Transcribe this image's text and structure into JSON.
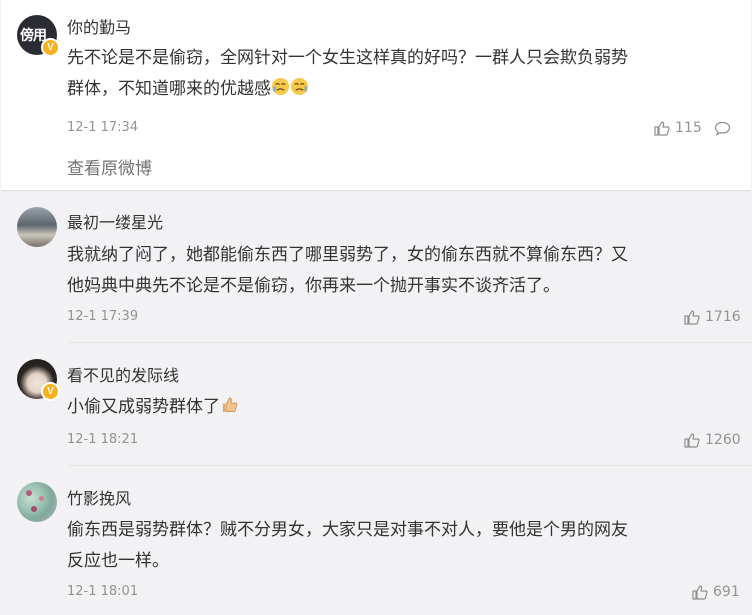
{
  "comments": [
    {
      "username": "你的勤马",
      "avatar_text": "傍用",
      "text_lines": [
        "先不论是不是偷窃，全网针对一个女生这样真的好吗？一群人只会欺负弱势",
        "群体，不知道哪来的优越感"
      ],
      "emojis": [
        "crying-face-emoji",
        "crying-face-emoji"
      ],
      "time": "12-1 17:34",
      "likes": "115",
      "view_original": "查看原微博"
    },
    {
      "username": "最初一缕星光",
      "text_lines": [
        "我就纳了闷了，她都能偷东西了哪里弱势了，女的偷东西就不算偷东西？又",
        "他妈典中典先不论是不是偷窃，你再来一个抛开事实不谈齐活了。"
      ],
      "time": "12-1 17:39",
      "likes": "1716"
    },
    {
      "username": "看不见的发际线",
      "text_lines": [
        "小偷又成弱势群体了"
      ],
      "emojis": [
        "thumbs-up-emoji"
      ],
      "time": "12-1 18:21",
      "likes": "1260"
    },
    {
      "username": "竹影挽风",
      "text_lines": [
        "偷东西是弱势群体？贼不分男女，大家只是对事不对人，要他是个男的网友",
        "反应也一样。"
      ],
      "time": "12-1 18:01",
      "likes": "691"
    }
  ],
  "colors": {
    "background": "#f2f2f5",
    "card": "#ffffff",
    "text": "#333333",
    "meta": "#939393",
    "verified_badge": "#f5b21a"
  },
  "icons": [
    "like-icon",
    "comment-icon",
    "verified-badge-icon"
  ]
}
